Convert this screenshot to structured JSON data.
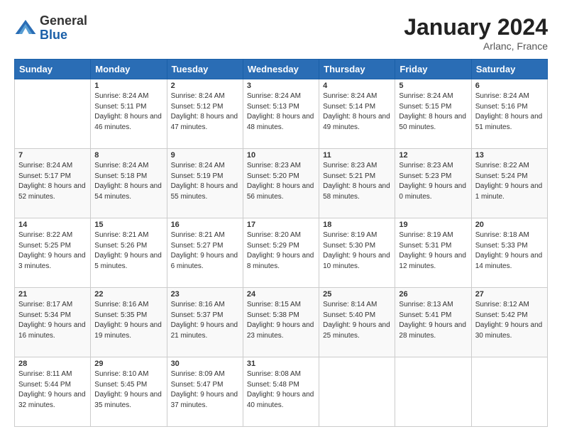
{
  "header": {
    "logo": {
      "general": "General",
      "blue": "Blue"
    },
    "month": "January 2024",
    "location": "Arlanc, France"
  },
  "days_of_week": [
    "Sunday",
    "Monday",
    "Tuesday",
    "Wednesday",
    "Thursday",
    "Friday",
    "Saturday"
  ],
  "weeks": [
    [
      {
        "day": "",
        "sunrise": "",
        "sunset": "",
        "daylight": ""
      },
      {
        "day": "1",
        "sunrise": "Sunrise: 8:24 AM",
        "sunset": "Sunset: 5:11 PM",
        "daylight": "Daylight: 8 hours and 46 minutes."
      },
      {
        "day": "2",
        "sunrise": "Sunrise: 8:24 AM",
        "sunset": "Sunset: 5:12 PM",
        "daylight": "Daylight: 8 hours and 47 minutes."
      },
      {
        "day": "3",
        "sunrise": "Sunrise: 8:24 AM",
        "sunset": "Sunset: 5:13 PM",
        "daylight": "Daylight: 8 hours and 48 minutes."
      },
      {
        "day": "4",
        "sunrise": "Sunrise: 8:24 AM",
        "sunset": "Sunset: 5:14 PM",
        "daylight": "Daylight: 8 hours and 49 minutes."
      },
      {
        "day": "5",
        "sunrise": "Sunrise: 8:24 AM",
        "sunset": "Sunset: 5:15 PM",
        "daylight": "Daylight: 8 hours and 50 minutes."
      },
      {
        "day": "6",
        "sunrise": "Sunrise: 8:24 AM",
        "sunset": "Sunset: 5:16 PM",
        "daylight": "Daylight: 8 hours and 51 minutes."
      }
    ],
    [
      {
        "day": "7",
        "sunrise": "Sunrise: 8:24 AM",
        "sunset": "Sunset: 5:17 PM",
        "daylight": "Daylight: 8 hours and 52 minutes."
      },
      {
        "day": "8",
        "sunrise": "Sunrise: 8:24 AM",
        "sunset": "Sunset: 5:18 PM",
        "daylight": "Daylight: 8 hours and 54 minutes."
      },
      {
        "day": "9",
        "sunrise": "Sunrise: 8:24 AM",
        "sunset": "Sunset: 5:19 PM",
        "daylight": "Daylight: 8 hours and 55 minutes."
      },
      {
        "day": "10",
        "sunrise": "Sunrise: 8:23 AM",
        "sunset": "Sunset: 5:20 PM",
        "daylight": "Daylight: 8 hours and 56 minutes."
      },
      {
        "day": "11",
        "sunrise": "Sunrise: 8:23 AM",
        "sunset": "Sunset: 5:21 PM",
        "daylight": "Daylight: 8 hours and 58 minutes."
      },
      {
        "day": "12",
        "sunrise": "Sunrise: 8:23 AM",
        "sunset": "Sunset: 5:23 PM",
        "daylight": "Daylight: 9 hours and 0 minutes."
      },
      {
        "day": "13",
        "sunrise": "Sunrise: 8:22 AM",
        "sunset": "Sunset: 5:24 PM",
        "daylight": "Daylight: 9 hours and 1 minute."
      }
    ],
    [
      {
        "day": "14",
        "sunrise": "Sunrise: 8:22 AM",
        "sunset": "Sunset: 5:25 PM",
        "daylight": "Daylight: 9 hours and 3 minutes."
      },
      {
        "day": "15",
        "sunrise": "Sunrise: 8:21 AM",
        "sunset": "Sunset: 5:26 PM",
        "daylight": "Daylight: 9 hours and 5 minutes."
      },
      {
        "day": "16",
        "sunrise": "Sunrise: 8:21 AM",
        "sunset": "Sunset: 5:27 PM",
        "daylight": "Daylight: 9 hours and 6 minutes."
      },
      {
        "day": "17",
        "sunrise": "Sunrise: 8:20 AM",
        "sunset": "Sunset: 5:29 PM",
        "daylight": "Daylight: 9 hours and 8 minutes."
      },
      {
        "day": "18",
        "sunrise": "Sunrise: 8:19 AM",
        "sunset": "Sunset: 5:30 PM",
        "daylight": "Daylight: 9 hours and 10 minutes."
      },
      {
        "day": "19",
        "sunrise": "Sunrise: 8:19 AM",
        "sunset": "Sunset: 5:31 PM",
        "daylight": "Daylight: 9 hours and 12 minutes."
      },
      {
        "day": "20",
        "sunrise": "Sunrise: 8:18 AM",
        "sunset": "Sunset: 5:33 PM",
        "daylight": "Daylight: 9 hours and 14 minutes."
      }
    ],
    [
      {
        "day": "21",
        "sunrise": "Sunrise: 8:17 AM",
        "sunset": "Sunset: 5:34 PM",
        "daylight": "Daylight: 9 hours and 16 minutes."
      },
      {
        "day": "22",
        "sunrise": "Sunrise: 8:16 AM",
        "sunset": "Sunset: 5:35 PM",
        "daylight": "Daylight: 9 hours and 19 minutes."
      },
      {
        "day": "23",
        "sunrise": "Sunrise: 8:16 AM",
        "sunset": "Sunset: 5:37 PM",
        "daylight": "Daylight: 9 hours and 21 minutes."
      },
      {
        "day": "24",
        "sunrise": "Sunrise: 8:15 AM",
        "sunset": "Sunset: 5:38 PM",
        "daylight": "Daylight: 9 hours and 23 minutes."
      },
      {
        "day": "25",
        "sunrise": "Sunrise: 8:14 AM",
        "sunset": "Sunset: 5:40 PM",
        "daylight": "Daylight: 9 hours and 25 minutes."
      },
      {
        "day": "26",
        "sunrise": "Sunrise: 8:13 AM",
        "sunset": "Sunset: 5:41 PM",
        "daylight": "Daylight: 9 hours and 28 minutes."
      },
      {
        "day": "27",
        "sunrise": "Sunrise: 8:12 AM",
        "sunset": "Sunset: 5:42 PM",
        "daylight": "Daylight: 9 hours and 30 minutes."
      }
    ],
    [
      {
        "day": "28",
        "sunrise": "Sunrise: 8:11 AM",
        "sunset": "Sunset: 5:44 PM",
        "daylight": "Daylight: 9 hours and 32 minutes."
      },
      {
        "day": "29",
        "sunrise": "Sunrise: 8:10 AM",
        "sunset": "Sunset: 5:45 PM",
        "daylight": "Daylight: 9 hours and 35 minutes."
      },
      {
        "day": "30",
        "sunrise": "Sunrise: 8:09 AM",
        "sunset": "Sunset: 5:47 PM",
        "daylight": "Daylight: 9 hours and 37 minutes."
      },
      {
        "day": "31",
        "sunrise": "Sunrise: 8:08 AM",
        "sunset": "Sunset: 5:48 PM",
        "daylight": "Daylight: 9 hours and 40 minutes."
      },
      {
        "day": "",
        "sunrise": "",
        "sunset": "",
        "daylight": ""
      },
      {
        "day": "",
        "sunrise": "",
        "sunset": "",
        "daylight": ""
      },
      {
        "day": "",
        "sunrise": "",
        "sunset": "",
        "daylight": ""
      }
    ]
  ]
}
